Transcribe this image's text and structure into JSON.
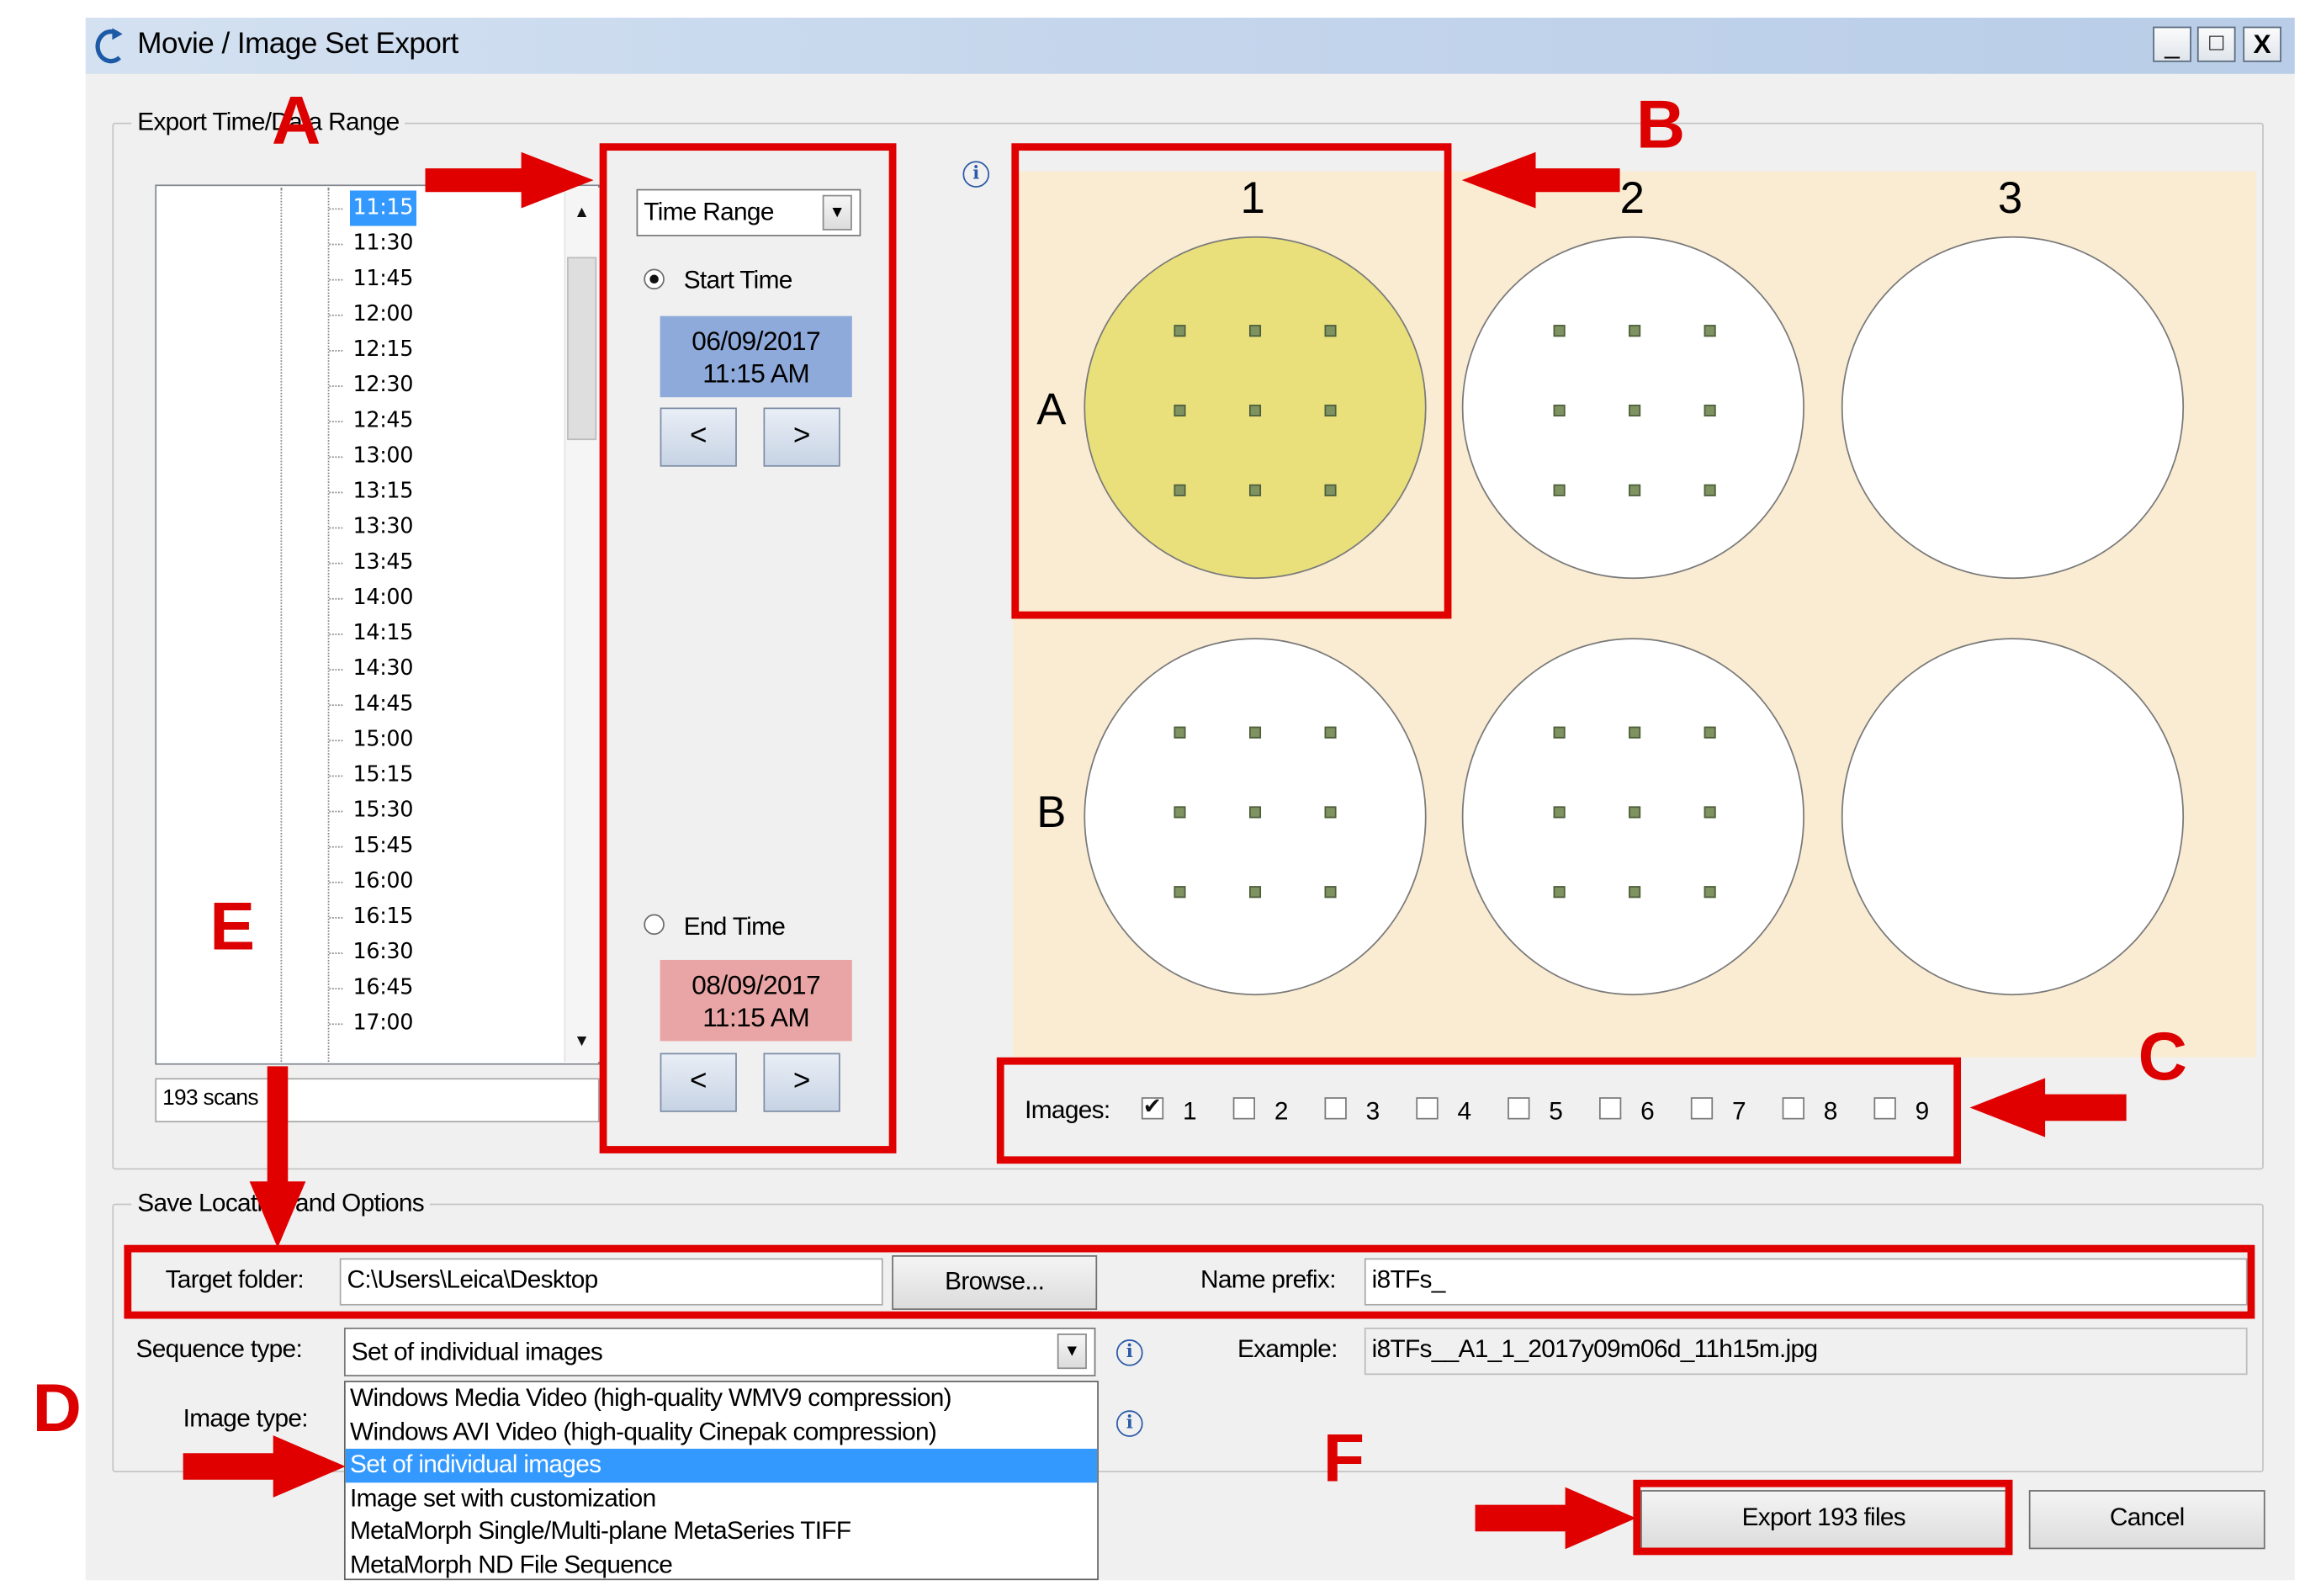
{
  "window": {
    "title": "Movie / Image Set Export",
    "controls": [
      "_",
      "□",
      "X"
    ]
  },
  "export_group": {
    "label": "Export Time/Data Range",
    "times": [
      "11:15",
      "11:30",
      "11:45",
      "12:00",
      "12:15",
      "12:30",
      "12:45",
      "13:00",
      "13:15",
      "13:30",
      "13:45",
      "14:00",
      "14:15",
      "14:30",
      "14:45",
      "15:00",
      "15:15",
      "15:30",
      "15:45",
      "16:00",
      "16:15",
      "16:30",
      "16:45",
      "17:00"
    ],
    "selected_time": "11:15",
    "scan_count": "193 scans"
  },
  "range": {
    "mode": "Time Range",
    "start_label": "Start Time",
    "start_date": "06/09/2017",
    "start_time": "11:15 AM",
    "end_label": "End Time",
    "end_date": "08/09/2017",
    "end_time": "11:15 AM",
    "prev": "<",
    "next": ">",
    "selected": "start"
  },
  "plate": {
    "columns": [
      "1",
      "2",
      "3"
    ],
    "rows": [
      "A",
      "B"
    ],
    "selected_well": "A1",
    "colors": {
      "plate_bg": "#faecd2",
      "selected_well": "#e9e07c",
      "position_dot": "#7f9360"
    }
  },
  "images": {
    "label": "Images:",
    "options": [
      {
        "label": "1",
        "checked": true
      },
      {
        "label": "2",
        "checked": false
      },
      {
        "label": "3",
        "checked": false
      },
      {
        "label": "4",
        "checked": false
      },
      {
        "label": "5",
        "checked": false
      },
      {
        "label": "6",
        "checked": false
      },
      {
        "label": "7",
        "checked": false
      },
      {
        "label": "8",
        "checked": false
      },
      {
        "label": "9",
        "checked": false
      }
    ]
  },
  "save_group": {
    "label": "Save Location and Options",
    "target_folder_label": "Target folder:",
    "target_folder": "C:\\Users\\Leica\\Desktop",
    "browse": "Browse...",
    "name_prefix_label": "Name prefix:",
    "name_prefix": "i8TFs_",
    "sequence_type_label": "Sequence type:",
    "sequence_type": "Set of individual images",
    "example_label": "Example:",
    "example": "i8TFs__A1_1_2017y09m06d_11h15m.jpg",
    "image_type_label": "Image type:",
    "dropdown_options": [
      "Windows Media Video (high-quality WMV9 compression)",
      "Windows AVI Video (high-quality Cinepak compression)",
      "Set of individual images",
      "Image set with customization",
      "MetaMorph Single/Multi-plane MetaSeries TIFF",
      "MetaMorph ND File Sequence"
    ],
    "selected_option": "Set of individual images"
  },
  "buttons": {
    "export": "Export 193 files",
    "cancel": "Cancel"
  },
  "annotations": {
    "A": "A",
    "B": "B",
    "C": "C",
    "D": "D",
    "E": "E",
    "F": "F",
    "color": "#e00000"
  },
  "icons": {
    "app": "refresh-icon",
    "info": "info-icon",
    "dropdown": "chevron-down-icon"
  }
}
